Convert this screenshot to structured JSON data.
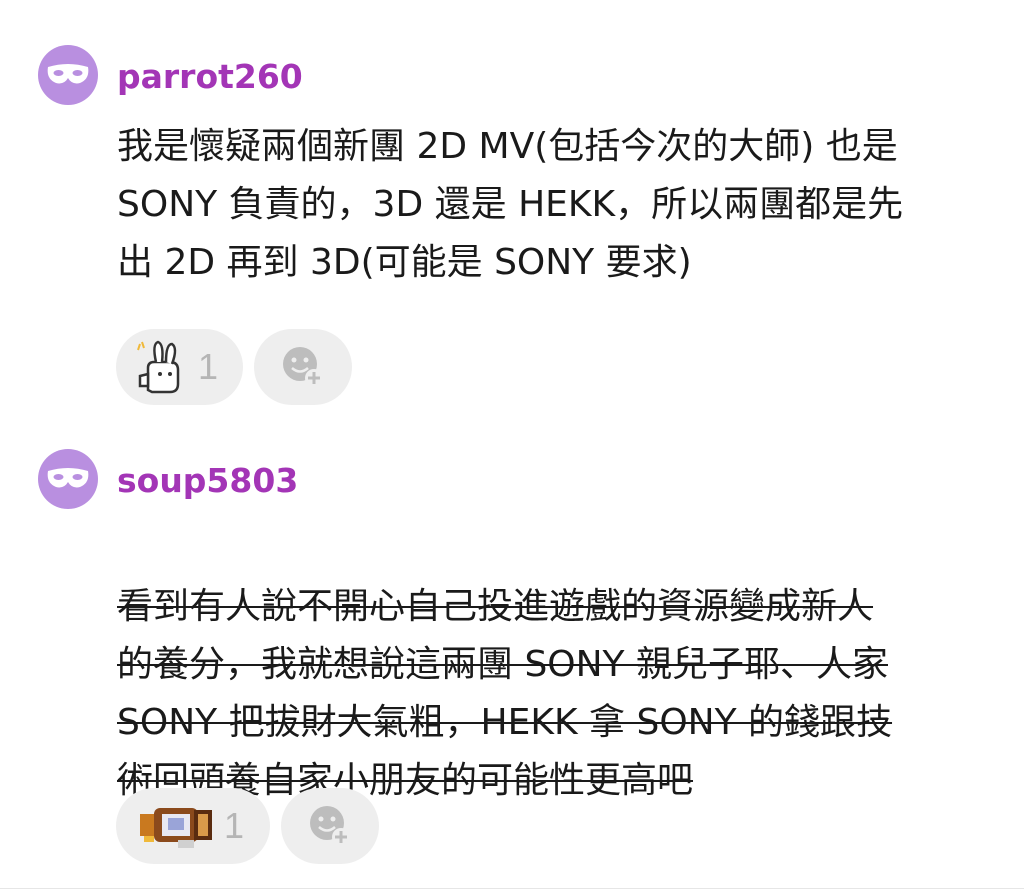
{
  "comments": [
    {
      "avatar_icon": "mask-icon",
      "username": "parrot260",
      "text": "我是懷疑兩個新團 2D MV(包括今次的大師) 也是\nSONY 負責的，3D 還是 HEKK，所以兩團都是先\n出 2D 再到 3D(可能是 SONY 要求)",
      "strikethrough": false,
      "reaction": {
        "icon": "bunny-sticker-icon",
        "count": "1"
      },
      "add_reaction_icon": "add-emoji-icon"
    },
    {
      "avatar_icon": "mask-icon",
      "username": "soup5803",
      "text": "看到有人說不開心自己投進遊戲的資源變成新人\n的養分，我就想說這兩團 SONY 親兒子耶、人家\nSONY 把拔財大氣粗，HEKK 拿 SONY 的錢跟技\n術回頭養自家小朋友的可能性更高吧",
      "strikethrough": true,
      "reaction": {
        "icon": "pixel-sticker-icon",
        "count": "1"
      },
      "add_reaction_icon": "add-emoji-icon"
    }
  ],
  "colors": {
    "username": "#a335b6",
    "avatar_bg": "#b98fe0",
    "pill_bg": "#eeeeee",
    "count": "#b5b5b5"
  }
}
